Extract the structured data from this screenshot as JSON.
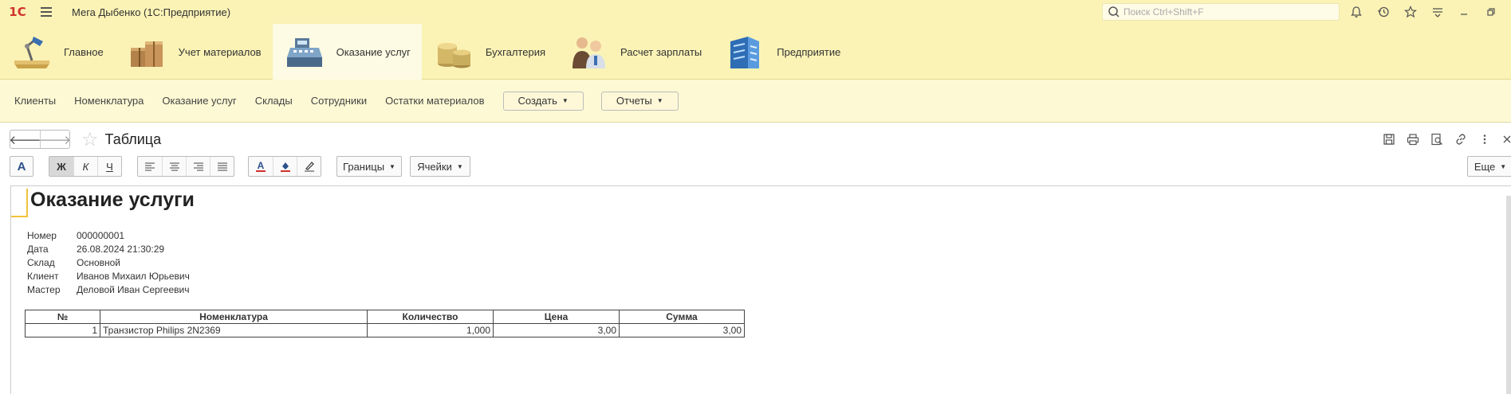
{
  "titlebar": {
    "logo": "1С",
    "title": "Мега Дыбенко  (1С:Предприятие)",
    "search_placeholder": "Поиск Ctrl+Shift+F"
  },
  "sections": [
    {
      "label": "Главное",
      "icon": "desk-lamp-icon"
    },
    {
      "label": "Учет материалов",
      "icon": "boxes-icon"
    },
    {
      "label": "Оказание услуг",
      "icon": "cash-register-icon",
      "active": true
    },
    {
      "label": "Бухгалтерия",
      "icon": "coins-icon"
    },
    {
      "label": "Расчет зарплаты",
      "icon": "people-icon"
    },
    {
      "label": "Предприятие",
      "icon": "building-icon"
    }
  ],
  "nav": {
    "links": [
      "Клиенты",
      "Номенклатура",
      "Оказание услуг",
      "Склады",
      "Сотрудники",
      "Остатки материалов"
    ],
    "create_label": "Создать",
    "reports_label": "Отчеты"
  },
  "form": {
    "title": "Таблица"
  },
  "toolbar": {
    "bold": "Ж",
    "italic": "К",
    "underline": "Ч",
    "borders_label": "Границы",
    "cells_label": "Ячейки",
    "more_label": "Еще"
  },
  "document": {
    "title": "Оказание услуги",
    "attributes": [
      {
        "key": "Номер",
        "value": "000000001"
      },
      {
        "key": "Дата",
        "value": "26.08.2024 21:30:29"
      },
      {
        "key": "Склад",
        "value": "Основной"
      },
      {
        "key": "Клиент",
        "value": "Иванов Михаил Юрьевич"
      },
      {
        "key": "Мастер",
        "value": "Деловой Иван Сергеевич"
      }
    ],
    "table": {
      "headers": [
        "№",
        "Номенклатура",
        "Количество",
        "Цена",
        "Сумма"
      ],
      "rows": [
        [
          "1",
          "Транзистор Philips 2N2369",
          "1,000",
          "3,00",
          "3,00"
        ]
      ]
    }
  },
  "colors": {
    "header_bg": "#fbf3b5",
    "nav_bg": "#fdf9d4",
    "active_section_bg": "#fdfbe3",
    "cursor": "#f2c23a",
    "logo": "#d0312d"
  }
}
